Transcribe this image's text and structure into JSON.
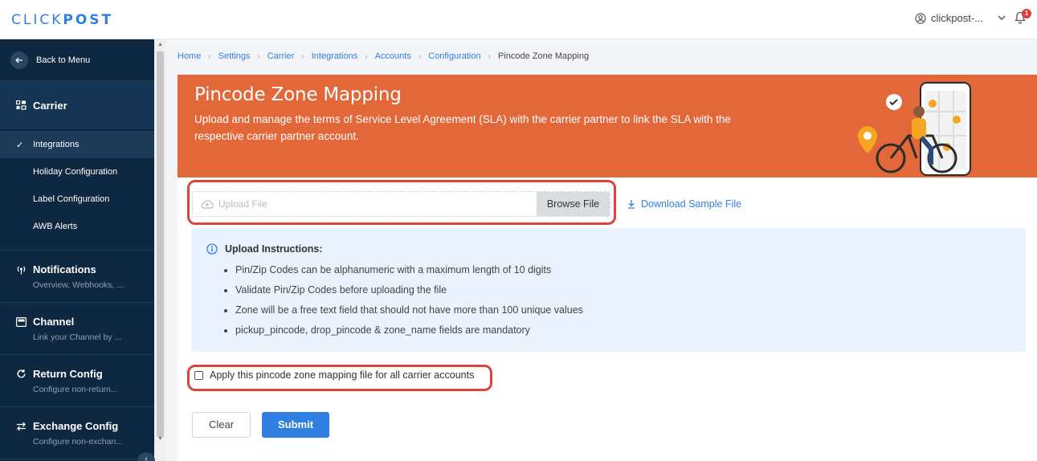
{
  "brand": {
    "logo_regular": "CLICK",
    "logo_bold": "POST"
  },
  "header": {
    "username": "clickpost-...",
    "notification_count": "1"
  },
  "sidebar": {
    "back_label": "Back to Menu",
    "carrier_label": "Carrier",
    "subitems": [
      "Integrations",
      "Holiday Configuration",
      "Label Configuration",
      "AWB Alerts"
    ],
    "sections": [
      {
        "title": "Notifications",
        "desc": "Overview, Webhooks, ..."
      },
      {
        "title": "Channel",
        "desc": "Link your Channel by ..."
      },
      {
        "title": "Return Config",
        "desc": "Configure non-return..."
      },
      {
        "title": "Exchange Config",
        "desc": "Configure non-exchan..."
      }
    ]
  },
  "breadcrumb": [
    "Home",
    "Settings",
    "Carrier",
    "Integrations",
    "Accounts",
    "Configuration",
    "Pincode Zone Mapping"
  ],
  "banner": {
    "title": "Pincode Zone Mapping",
    "description": "Upload and manage the terms of Service Level Agreement (SLA) with the carrier partner to link the SLA with the respective carrier partner account.",
    "accent_color": "#e2683a"
  },
  "upload": {
    "placeholder": "Upload File",
    "browse_label": "Browse File",
    "download_label": "Download Sample File"
  },
  "instructions": {
    "title": "Upload Instructions:",
    "items": [
      "Pin/Zip Codes can be alphanumeric with a maximum length of 10 digits",
      "Validate Pin/Zip Codes before uploading the file",
      "Zone will be a free text field that should not have more than 100 unique values",
      "pickup_pincode, drop_pincode & zone_name fields are mandatory"
    ]
  },
  "apply_all": {
    "label": "Apply this pincode zone mapping file for all carrier accounts",
    "checked": false
  },
  "actions": {
    "clear_label": "Clear",
    "submit_label": "Submit"
  },
  "colors": {
    "primary": "#2f7fe0",
    "sidebar_bg": "#0f2841",
    "highlight": "#d9453a"
  }
}
